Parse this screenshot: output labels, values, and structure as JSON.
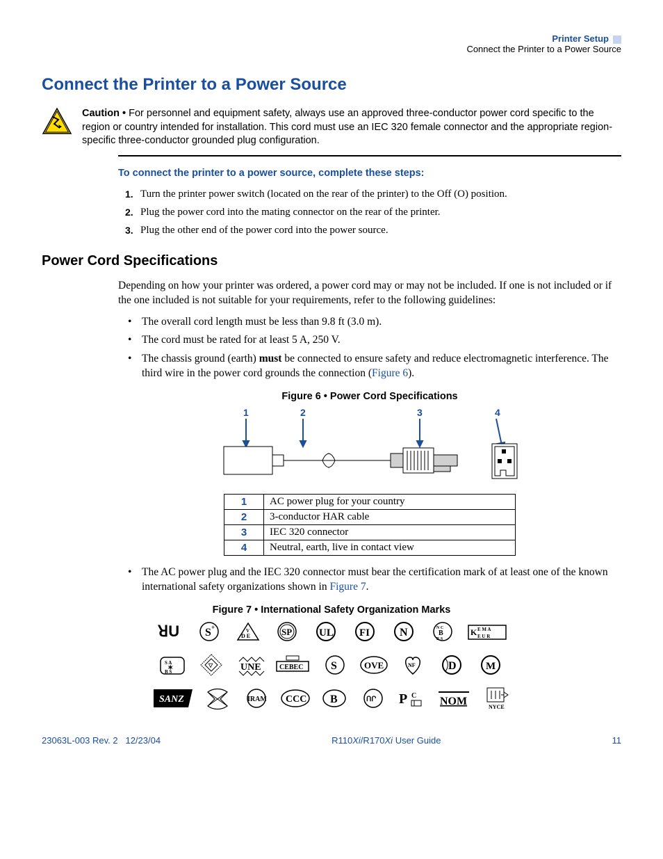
{
  "header": {
    "chapter": "Printer Setup",
    "section": "Connect the Printer to a Power Source"
  },
  "h1": "Connect the Printer to a Power Source",
  "caution": {
    "label": "Caution •",
    "text": " For personnel and equipment safety, always use an approved three-conductor power cord specific to the region or country intended for installation. This cord must use an IEC 320 female connector and the appropriate region-specific three-conductor grounded plug configuration."
  },
  "steps_heading": "To connect the printer to a power source, complete these steps:",
  "steps": [
    {
      "n": "1.",
      "t": "Turn the printer power switch (located on the rear of the printer) to the Off (O) position."
    },
    {
      "n": "2.",
      "t": "Plug the power cord into the mating connector on the rear of the printer."
    },
    {
      "n": "3.",
      "t": "Plug the other end of the power cord into the power source."
    }
  ],
  "h2": "Power Cord Specifications",
  "spec_intro": "Depending on how your printer was ordered, a power cord may or may not be included. If one is not included or if the one included is not suitable for your requirements, refer to the following guidelines:",
  "bullets1": [
    "The overall cord length must be less than 9.8 ft (3.0 m).",
    "The cord must be rated for at least 5 A, 250 V."
  ],
  "bullet_must_pre": "The chassis ground (earth) ",
  "bullet_must_bold": "must",
  "bullet_must_post": " be connected to ensure safety and reduce electromagnetic interference. The third wire in the power cord grounds the connection (",
  "bullet_must_link": "Figure 6",
  "bullet_must_close": ").",
  "fig6_caption": "Figure 6 • Power Cord Specifications",
  "fig6_labels": {
    "l1": "1",
    "l2": "2",
    "l3": "3",
    "l4": "4"
  },
  "legend": [
    {
      "k": "1",
      "v": "AC power plug for your country"
    },
    {
      "k": "2",
      "v": "3-conductor HAR cable"
    },
    {
      "k": "3",
      "v": "IEC 320 connector"
    },
    {
      "k": "4",
      "v": "Neutral, earth, live in contact view"
    }
  ],
  "bullet2_pre": "The AC power plug and the IEC 320 connector must bear the certification mark of at least one of the known international safety organizations shown in ",
  "bullet2_link": "Figure 7",
  "bullet2_post": ".",
  "fig7_caption": "Figure 7 • International Safety Organization Marks",
  "footer": {
    "left_rev": "23063L-003 Rev. 2",
    "left_date": "12/23/04",
    "mid_pre": "R110",
    "mid_i1": "Xi",
    "mid_mid": "/R170",
    "mid_i2": "Xi",
    "mid_post": " User Guide",
    "page": "11"
  }
}
